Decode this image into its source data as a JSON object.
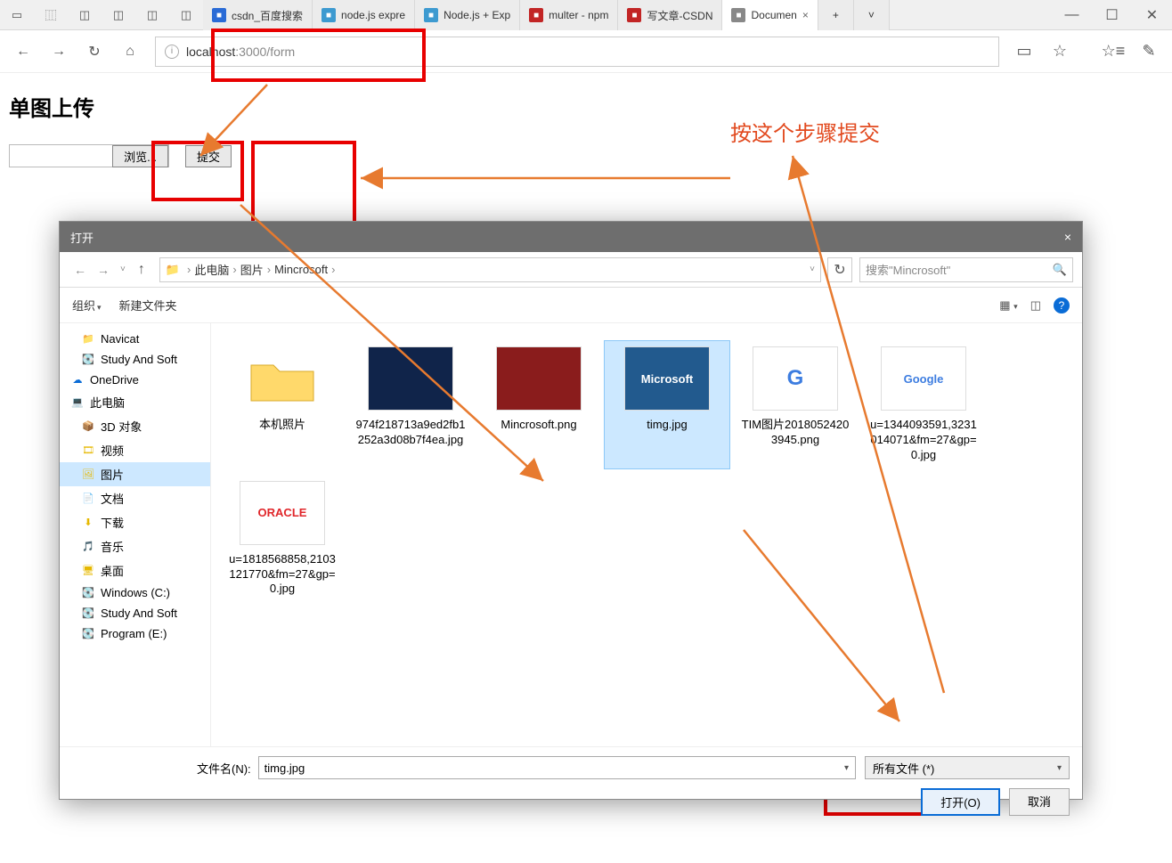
{
  "browser": {
    "tabs": [
      {
        "title": "csdn_百度搜索",
        "favcolor": "#2a6bd6"
      },
      {
        "title": "node.js expre",
        "favcolor": "#3d9ad0"
      },
      {
        "title": "Node.js + Exp",
        "favcolor": "#3d9ad0"
      },
      {
        "title": "multer - npm",
        "favcolor": "#c22525"
      },
      {
        "title": "写文章-CSDN",
        "favcolor": "#c22525"
      },
      {
        "title": "Documen",
        "favcolor": "#888",
        "active": true,
        "close": "×"
      }
    ],
    "newtab": "+",
    "url_host": "localhost",
    "url_port_path": ":3000/form"
  },
  "page": {
    "heading": "单图上传",
    "browse": "浏览...",
    "submit": "提交"
  },
  "annotation": {
    "text": "按这个步骤提交"
  },
  "dialog": {
    "title": "打开",
    "close": "×",
    "breadcrumb": [
      "此电脑",
      "图片",
      "Mincrosoft"
    ],
    "search_placeholder": "搜索\"Mincrosoft\"",
    "toolbar": {
      "organize": "组织",
      "newfolder": "新建文件夹"
    },
    "tree": [
      {
        "label": "Navicat",
        "icon": "📁",
        "level": 2
      },
      {
        "label": "Study And Soft",
        "icon": "💽",
        "level": 2
      },
      {
        "label": "OneDrive",
        "icon": "☁",
        "level": 1,
        "color": "#0a6cd6"
      },
      {
        "label": "此电脑",
        "icon": "💻",
        "level": 1
      },
      {
        "label": "3D 对象",
        "icon": "📦",
        "level": 2
      },
      {
        "label": "视频",
        "icon": "🎞",
        "level": 2
      },
      {
        "label": "图片",
        "icon": "🖼",
        "level": 2,
        "sel": true
      },
      {
        "label": "文档",
        "icon": "📄",
        "level": 2
      },
      {
        "label": "下载",
        "icon": "⬇",
        "level": 2
      },
      {
        "label": "音乐",
        "icon": "🎵",
        "level": 2
      },
      {
        "label": "桌面",
        "icon": "🖥",
        "level": 2
      },
      {
        "label": "Windows (C:)",
        "icon": "💽",
        "level": 2
      },
      {
        "label": "Study And Soft",
        "icon": "💽",
        "level": 2
      },
      {
        "label": "Program (E:)",
        "icon": "💽",
        "level": 2
      }
    ],
    "files": [
      {
        "name": "本机照片",
        "type": "folder"
      },
      {
        "name": "974f218713a9ed2fb1252a3d08b7f4ea.jpg",
        "type": "img",
        "bg": "#10244a"
      },
      {
        "name": "Mincrosoft.png",
        "type": "img",
        "bg": "#8a1c1c"
      },
      {
        "name": "timg.jpg",
        "type": "img",
        "bg": "#225a8e",
        "sel": true,
        "logo": "Microsoft"
      },
      {
        "name": "TIM图片20180524203945.png",
        "type": "img",
        "bg": "#fff",
        "logo": "G"
      },
      {
        "name": "u=1344093591,3231014071&fm=27&gp=0.jpg",
        "type": "img",
        "bg": "#fff",
        "logo": "Google"
      },
      {
        "name": "u=1818568858,2103121770&fm=27&gp=0.jpg",
        "type": "img",
        "bg": "#fff",
        "logo": "ORACLE"
      }
    ],
    "filename_label": "文件名(N):",
    "filename_value": "timg.jpg",
    "filter": "所有文件 (*)",
    "open_btn": "打开(O)",
    "cancel_btn": "取消"
  }
}
